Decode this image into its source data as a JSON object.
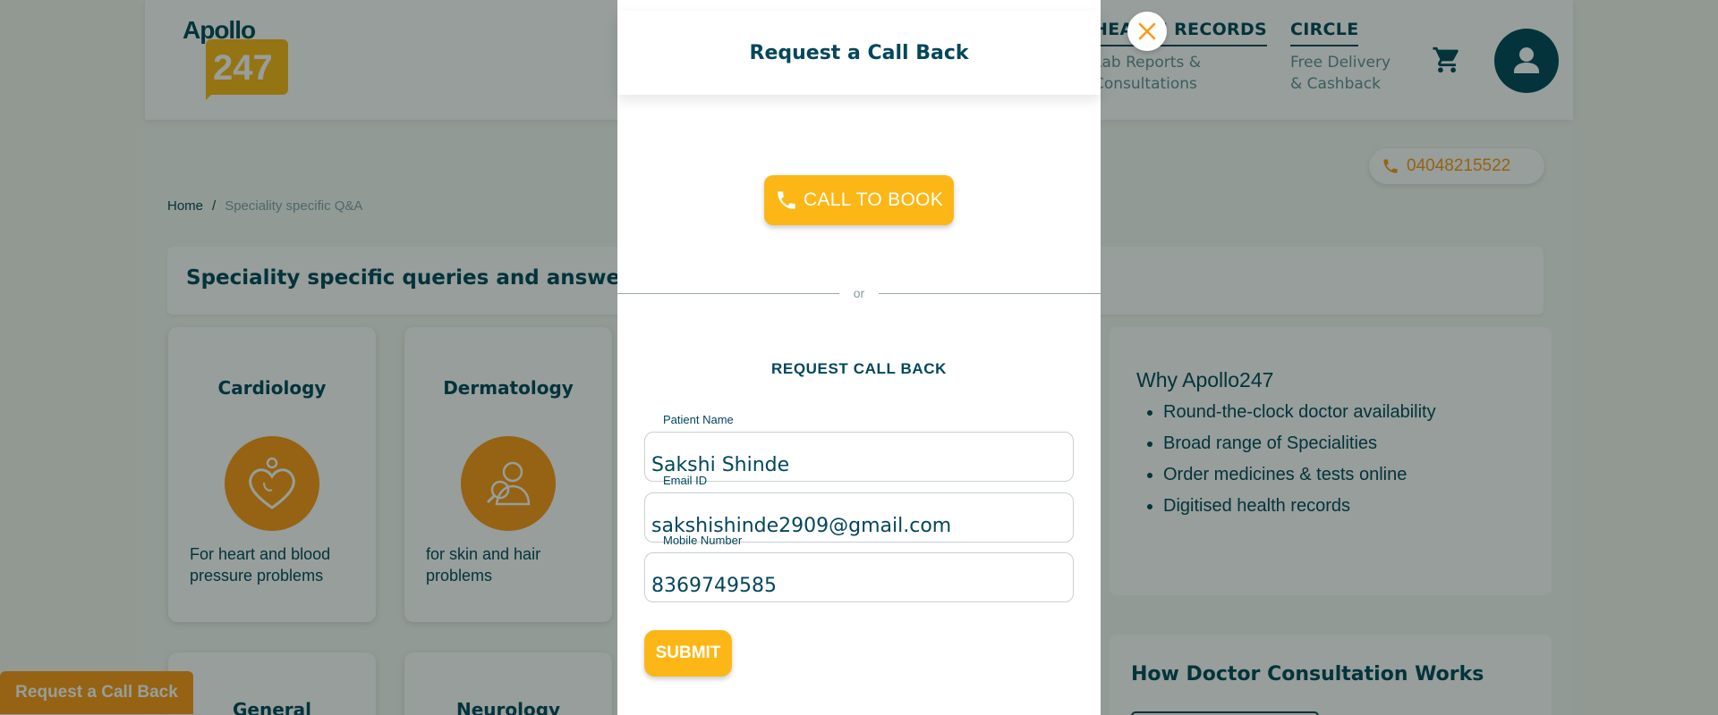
{
  "header": {
    "logo_text": "Apollo",
    "logo_number": "247",
    "nav": [
      {
        "title": "HEALTH RECORDS",
        "subtitle": "Lab Reports & Consultations"
      },
      {
        "title": "CIRCLE",
        "subtitle": "Free Delivery & Cashback"
      }
    ],
    "cart_icon": "cart-icon",
    "avatar_icon": "user-icon"
  },
  "phone_pill": {
    "number": "04048215522",
    "icon": "phone-icon"
  },
  "breadcrumb": {
    "home": "Home",
    "separator": "/",
    "current": "Speciality specific Q&A"
  },
  "section": {
    "title": "Speciality specific queries and answers"
  },
  "cards": [
    {
      "title": "Cardiology",
      "desc": "For heart and blood pressure problems",
      "icon": "heart-stethoscope-icon"
    },
    {
      "title": "Dermatology",
      "desc": "for skin and hair problems",
      "icon": "skin-doctor-icon"
    },
    {
      "title": "General",
      "desc": "",
      "icon": ""
    },
    {
      "title": "Neurology",
      "desc": "",
      "icon": ""
    }
  ],
  "why": {
    "title": "Why Apollo247",
    "items": [
      "Round-the-clock doctor availability",
      "Broad range of Specialities",
      "Order medicines & tests online",
      "Digitised health records"
    ]
  },
  "how": {
    "title": "How Doctor Consultation Works"
  },
  "callback_tab": {
    "label": "Request a Call Back"
  },
  "modal": {
    "title": "Request a Call Back",
    "close_icon": "close-icon",
    "call_button": "CALL TO BOOK",
    "divider_text": "or",
    "form_heading": "REQUEST CALL BACK",
    "fields": {
      "name": {
        "label": "Patient Name",
        "value": "Sakshi Shinde"
      },
      "email": {
        "label": "Email ID",
        "value": "sakshishinde2909@gmail.com"
      },
      "mobile": {
        "label": "Mobile Number",
        "value": "8369749585"
      }
    },
    "submit": "SUBMIT"
  },
  "colors": {
    "primary": "#02475b",
    "accent": "#fcb716",
    "orange": "#fc9916"
  }
}
